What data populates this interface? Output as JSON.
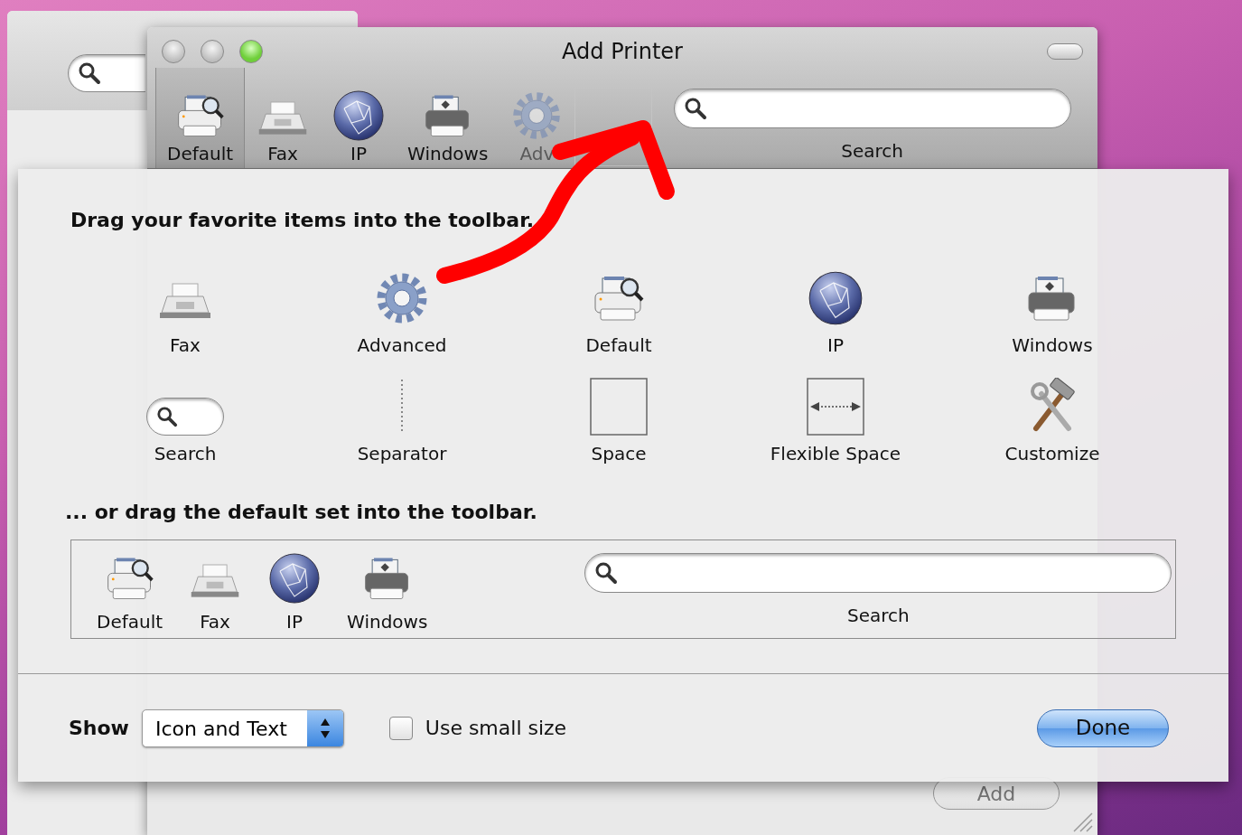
{
  "window": {
    "title": "Add Printer",
    "controls": [
      {
        "kind": "close",
        "active": false
      },
      {
        "kind": "minimize",
        "active": false
      },
      {
        "kind": "zoom",
        "active": true
      }
    ]
  },
  "toolbar": {
    "items": [
      {
        "label": "Default",
        "kind": "default",
        "selected": true,
        "dimmed": false
      },
      {
        "label": "Fax",
        "kind": "fax",
        "selected": false,
        "dimmed": false
      },
      {
        "label": "IP",
        "kind": "ip",
        "selected": false,
        "dimmed": false
      },
      {
        "label": "Windows",
        "kind": "windows",
        "selected": false,
        "dimmed": false
      },
      {
        "label": "Adv",
        "kind": "advanced",
        "selected": false,
        "dimmed": true
      }
    ],
    "search": {
      "label": "Search"
    }
  },
  "sheet": {
    "heading": "Drag your favorite items into the toolbar.",
    "palette": [
      {
        "label": "Fax",
        "kind": "fax"
      },
      {
        "label": "Advanced",
        "kind": "advanced"
      },
      {
        "label": "Default",
        "kind": "default"
      },
      {
        "label": "IP",
        "kind": "ip"
      },
      {
        "label": "Windows",
        "kind": "windows"
      },
      {
        "label": "Search",
        "kind": "search"
      },
      {
        "label": "Separator",
        "kind": "separator"
      },
      {
        "label": "Space",
        "kind": "space"
      },
      {
        "label": "Flexible Space",
        "kind": "flexible-space"
      },
      {
        "label": "Customize",
        "kind": "customize"
      }
    ],
    "default_heading": "... or drag the default set into the toolbar.",
    "default_set": [
      {
        "label": "Default",
        "kind": "default"
      },
      {
        "label": "Fax",
        "kind": "fax"
      },
      {
        "label": "IP",
        "kind": "ip"
      },
      {
        "label": "Windows",
        "kind": "windows"
      }
    ],
    "default_search": {
      "label": "Search"
    },
    "show_label": "Show",
    "show_value": "Icon and Text",
    "small_size": {
      "label": "Use small size",
      "checked": false
    },
    "done": "Done"
  },
  "back_window": {
    "add_button": "Add"
  }
}
